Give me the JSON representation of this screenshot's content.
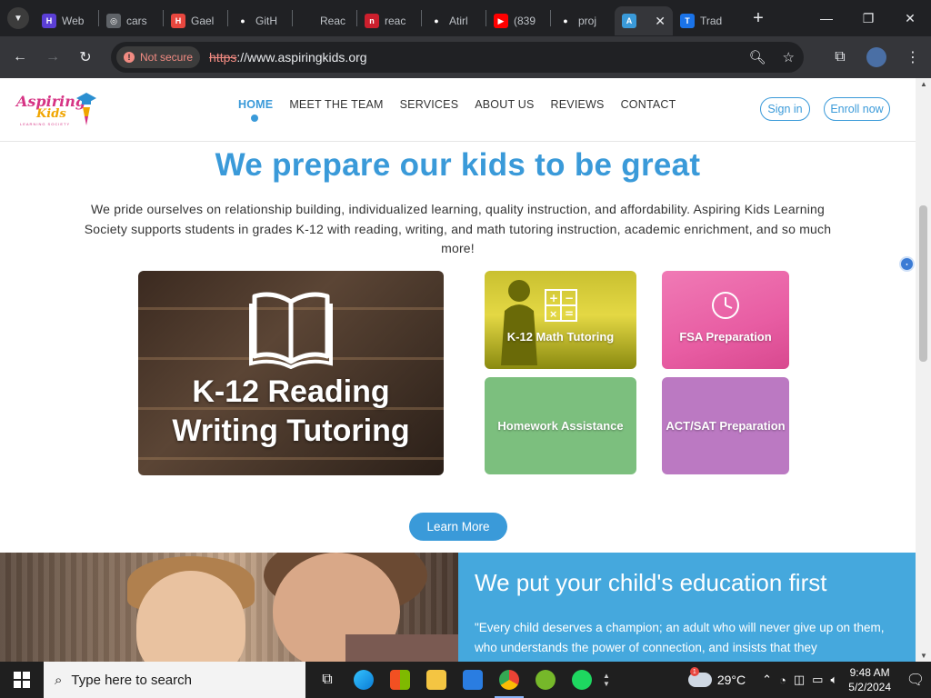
{
  "browser": {
    "tabs": [
      {
        "title": "Web",
        "fav_color": "#5b3fd6",
        "fav_text": "H"
      },
      {
        "title": "cars",
        "fav_color": "#5f6368",
        "fav_text": "◎"
      },
      {
        "title": "Gael",
        "fav_color": "#e8473f",
        "fav_text": "H"
      },
      {
        "title": "GitH",
        "fav_color": "#202124",
        "fav_text": "●"
      },
      {
        "title": "Reac",
        "fav_color": "#202124",
        "fav_text": ""
      },
      {
        "title": "reac",
        "fav_color": "#cc1f2d",
        "fav_text": "n"
      },
      {
        "title": "Atirl",
        "fav_color": "#202124",
        "fav_text": "●"
      },
      {
        "title": "(839",
        "fav_color": "#ff0000",
        "fav_text": "▶"
      },
      {
        "title": "proj",
        "fav_color": "#202124",
        "fav_text": "●"
      },
      {
        "title": "",
        "fav_color": "#3a9ad9",
        "fav_text": "A",
        "active": true
      },
      {
        "title": "Trad",
        "fav_color": "#1a73e8",
        "fav_text": "T"
      }
    ],
    "close_tab": "✕",
    "new_tab": "+",
    "not_secure": "Not secure",
    "url_scheme": "https",
    "url_rest": "://www.aspiringkids.org"
  },
  "site": {
    "logo_line1": "Aspiring",
    "logo_line2": "Kids",
    "logo_line3": "LEARNING SOCIETY",
    "nav": [
      "HOME",
      "MEET THE TEAM",
      "SERVICES",
      "ABOUT US",
      "REVIEWS",
      "CONTACT"
    ],
    "sign_in": "Sign in",
    "enroll": "Enroll now",
    "hero_title": "We prepare our kids to be great",
    "hero_text": "We pride ourselves on relationship building, individualized learning, quality instruction, and affordability. Aspiring Kids Learning Society supports students in grades K-12 with reading, writing, and math tutoring instruction, academic enrichment, and so much more!",
    "card_reading_line1": "K-12 Reading",
    "card_reading_line2": "Writing Tutoring",
    "card_math": "K-12 Math Tutoring",
    "card_fsa": "FSA Preparation",
    "card_homework": "Homework Assistance",
    "card_act": "ACT/SAT Preparation",
    "learn_more": "Learn More",
    "section_title": "We put your child's education first",
    "section_quote": "\"Every child deserves a champion; an adult who will never give up on them, who understands the power of connection, and insists that they"
  },
  "taskbar": {
    "search_placeholder": "Type here to search",
    "temperature": "29°C",
    "weather_badge": "1",
    "time": "9:48 AM",
    "date": "5/2/2024"
  }
}
